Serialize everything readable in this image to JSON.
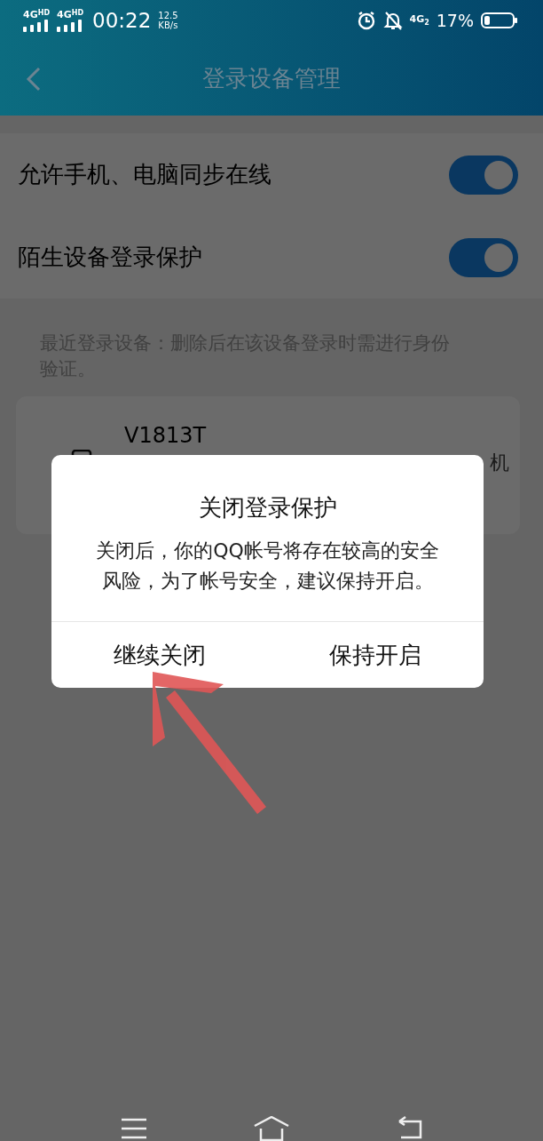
{
  "status_bar": {
    "signals": [
      "4G$^{HD}$",
      "4G$^{HD}$"
    ],
    "time": "00:22",
    "speed": "12.5",
    "speed_unit": "KB/s",
    "network": "4G$_{2}$",
    "battery": "17%"
  },
  "header": {
    "title": "登录设备管理"
  },
  "settings": [
    {
      "label": "允许手机、电脑同步在线",
      "on": true
    },
    {
      "label": "陌生设备登录保护",
      "on": true
    }
  ],
  "hint": "最近登录设备：删除后在该设备登录时需进行身份验证。",
  "devices": [
    {
      "name": "V1813T",
      "detail": "机"
    }
  ],
  "dialog": {
    "title": "关闭登录保护",
    "message": "关闭后，你的QQ帐号将存在较高的安全风险，为了帐号安全，建议保持开启。",
    "buttons": [
      {
        "label": "继续关闭"
      },
      {
        "label": "保持开启"
      }
    ]
  }
}
